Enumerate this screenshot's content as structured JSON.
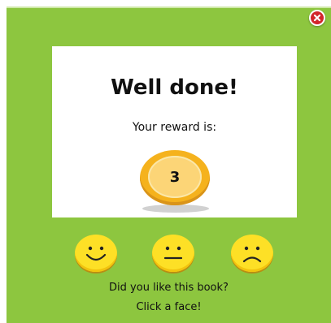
{
  "dialog": {
    "title": "Well done!",
    "reward_label": "Your reward is:",
    "reward_value": "3",
    "question": "Did you like this book?",
    "hint": "Click a face!"
  },
  "faces": [
    {
      "mood": "happy",
      "icon": "happy-face-icon"
    },
    {
      "mood": "neutral",
      "icon": "neutral-face-icon"
    },
    {
      "mood": "sad",
      "icon": "sad-face-icon"
    }
  ],
  "colors": {
    "background": "#8dc63f",
    "card": "#ffffff",
    "coin": "#f5b21d",
    "face": "#fde026",
    "close": "#d2262b"
  },
  "icons": {
    "close": "close-icon",
    "coin": "coin-icon"
  }
}
